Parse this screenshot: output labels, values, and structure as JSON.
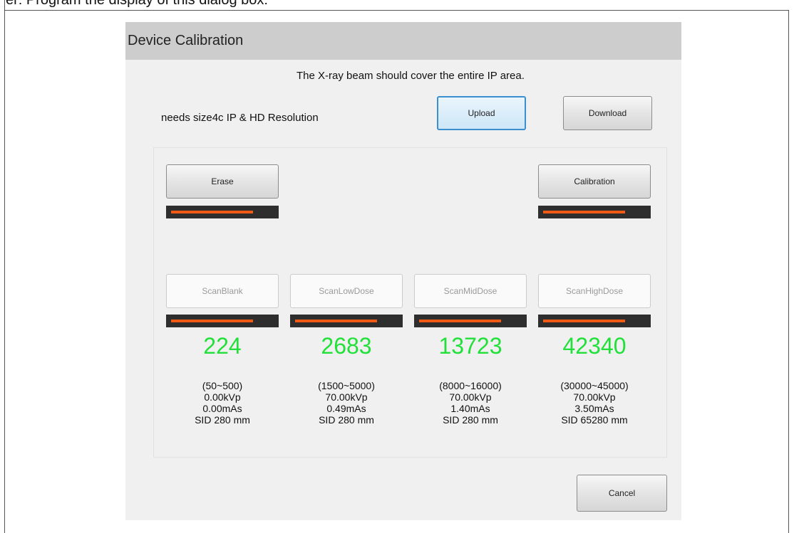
{
  "page": {
    "caption": "er:  Program the display of this dialog box:"
  },
  "dialog": {
    "title": "Device Calibration",
    "instruction": "The X-ray beam should cover the entire IP area.",
    "requirement": "needs  size4c IP  & HD Resolution",
    "upload_label": "Upload",
    "download_label": "Download",
    "cancel_label": "Cancel"
  },
  "top_actions": {
    "erase": {
      "label": "Erase",
      "progress": 0.8
    },
    "calibration": {
      "label": "Calibration",
      "progress": 0.8
    }
  },
  "scans": [
    {
      "label": "ScanBlank",
      "progress": 0.8,
      "count": "224",
      "range": "(50~500)",
      "kvp": "0.00kVp",
      "mas": "0.00mAs",
      "sid": "SID 280 mm"
    },
    {
      "label": "ScanLowDose",
      "progress": 0.8,
      "count": "2683",
      "range": "(1500~5000)",
      "kvp": "70.00kVp",
      "mas": "0.49mAs",
      "sid": "SID 280 mm"
    },
    {
      "label": "ScanMidDose",
      "progress": 0.8,
      "count": "13723",
      "range": "(8000~16000)",
      "kvp": "70.00kVp",
      "mas": "1.40mAs",
      "sid": "SID 280 mm"
    },
    {
      "label": "ScanHighDose",
      "progress": 0.8,
      "count": "42340",
      "range": "(30000~45000)",
      "kvp": "70.00kVp",
      "mas": "3.50mAs",
      "sid": "SID 65280 mm"
    }
  ],
  "colors": {
    "progress_fill": "#f05a14",
    "progress_track": "#2e2e2e",
    "count_text": "#22e03a",
    "title_bar": "#cdcdcd"
  }
}
